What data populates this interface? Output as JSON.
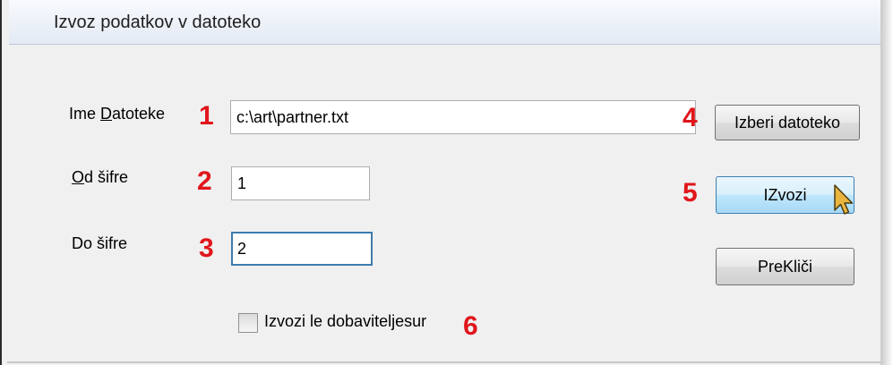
{
  "window": {
    "title": "Izvoz podatkov v datoteko"
  },
  "form": {
    "filename_label_pre": "Ime ",
    "filename_label_accel": "D",
    "filename_label_post": "atoteke",
    "filename_value": "c:\\art\\partner.txt",
    "from_label_accel": "O",
    "from_label_post": "d šifre",
    "from_value": "1",
    "to_label": "Do šifre",
    "to_value": "2",
    "checkbox_label": "Izvozi le dobaviteljesur",
    "checkbox_checked": false
  },
  "buttons": {
    "browse_label": "Izberi datoteko",
    "export_label": "IZvozi",
    "cancel_label": "PreKliči"
  },
  "markers": [
    "1",
    "2",
    "3",
    "4",
    "5",
    "6"
  ],
  "colors": {
    "marker": "#e0161c",
    "focus_border": "#3d7bad"
  },
  "cursor": {
    "icon": "mouse-pointer-icon"
  }
}
